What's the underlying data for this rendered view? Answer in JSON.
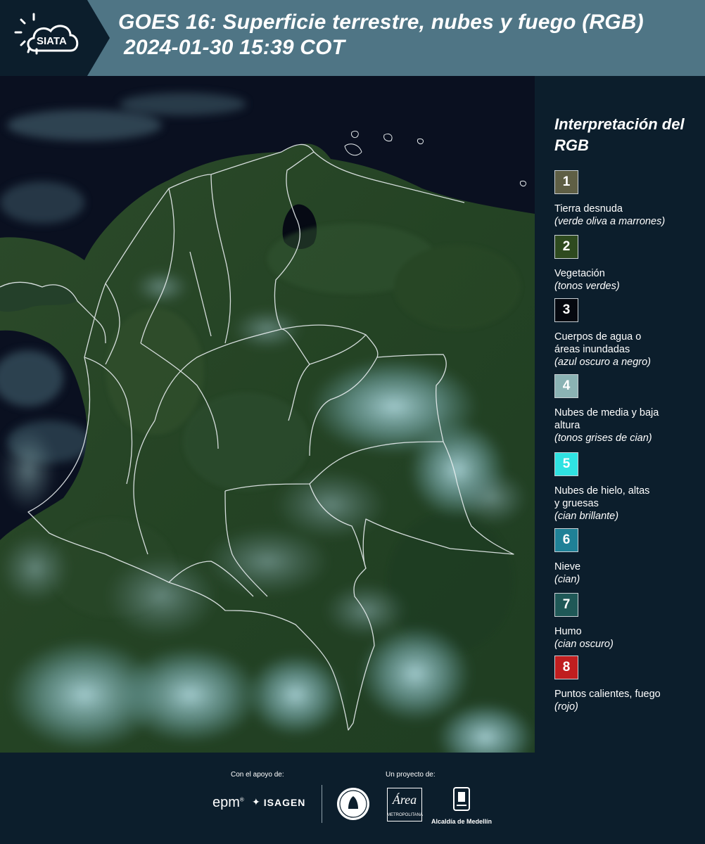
{
  "header": {
    "brand": "SIATA",
    "title_line1": "GOES 16: Superficie terrestre, nubes y fuego (RGB)",
    "title_line2": "2024-01-30 15:39 COT",
    "bg_color": "#4f7585"
  },
  "legend": {
    "title": "Interpretación del RGB",
    "items": [
      {
        "number": "1",
        "color": "#5f5f45",
        "label": "Tierra desnuda",
        "sub": "(verde oliva a marrones)"
      },
      {
        "number": "2",
        "color": "#2e4a1f",
        "label": "Vegetación",
        "sub": "(tonos verdes)"
      },
      {
        "number": "3",
        "color": "#05080f",
        "label": "Cuerpos de agua o áreas inundadas",
        "sub": "(azul oscuro a negro)"
      },
      {
        "number": "4",
        "color": "#8bb3b4",
        "label": "Nubes de media y baja altura",
        "sub": "(tonos grises de cian)"
      },
      {
        "number": "5",
        "color": "#2fe2e2",
        "label": "Nubes de hielo, altas y gruesas",
        "sub": "(cian brillante)"
      },
      {
        "number": "6",
        "color": "#1f8197",
        "label": "Nieve",
        "sub": "(cian)"
      },
      {
        "number": "7",
        "color": "#1f5857",
        "label": "Humo",
        "sub": "(cian oscuro)"
      },
      {
        "number": "8",
        "color": "#c01e1f",
        "label": "Puntos calientes, fuego",
        "sub": "(rojo)"
      }
    ]
  },
  "footer": {
    "support_label": "Con el apoyo de:",
    "project_label": "Un proyecto de:",
    "epm": "epm",
    "isagen": "ISAGEN",
    "amva_name": "Área",
    "amva_small": "METROPOLITANA",
    "alcaldia": "Alcaldía de Medellín"
  }
}
